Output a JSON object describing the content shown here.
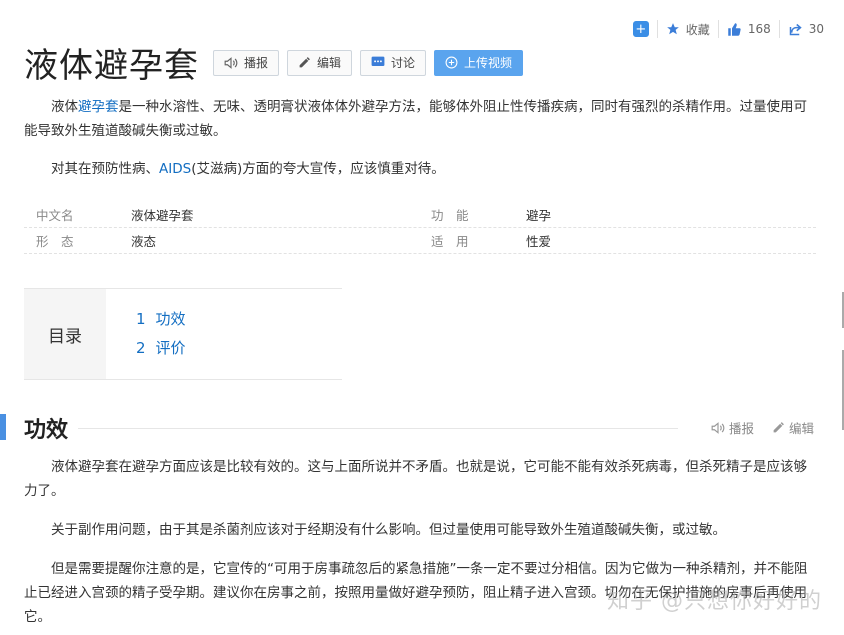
{
  "header": {
    "title": "液体避孕套",
    "buttons": {
      "play": "播报",
      "edit": "编辑",
      "discuss": "讨论",
      "upload": "上传视频"
    }
  },
  "actions": {
    "favorite": "收藏",
    "likes": "168",
    "shares": "30"
  },
  "summary": {
    "p1_before": "液体",
    "p1_link": "避孕套",
    "p1_after": "是一种水溶性、无味、透明膏状液体体外避孕方法，能够体外阻止性传播疾病，同时有强烈的杀精作用。过量使用可能导致外生殖道酸碱失衡或过敏。",
    "p2_before": "对其在预防性病、",
    "p2_link": "AIDS",
    "p2_after": "(艾滋病)方面的夸大宣传，应该慎重对待。"
  },
  "infobox": {
    "rows": [
      {
        "k1": "中文名",
        "v1": "液体避孕套",
        "k2": "功　能",
        "v2": "避孕"
      },
      {
        "k1": "形　态",
        "v1": "液态",
        "k2": "适　用",
        "v2": "性爱"
      }
    ]
  },
  "toc": {
    "label": "目录",
    "items": [
      {
        "n": "1",
        "text": "功效"
      },
      {
        "n": "2",
        "text": "评价"
      }
    ]
  },
  "section": {
    "title": "功效",
    "tools": {
      "play": "播报",
      "edit": "编辑"
    },
    "paragraphs": [
      "液体避孕套在避孕方面应该是比较有效的。这与上面所说并不矛盾。也就是说，它可能不能有效杀死病毒，但杀死精子是应该够力了。",
      "关于副作用问题，由于其是杀菌剂应该对于经期没有什么影响。但过量使用可能导致外生殖道酸碱失衡，或过敏。",
      "但是需要提醒你注意的是，它宣传的“可用于房事疏忽后的紧急措施”一条一定不要过分相信。因为它做为一种杀精剂，并不能阻止已经进入宫颈的精子受孕期。建议你在房事之前，按照用量做好避孕预防，阻止精子进入宫颈。切勿在无保护措施的房事后再使用它。"
    ]
  },
  "watermark": "知乎 @只想你好好的",
  "colors": {
    "link": "#136ec2",
    "accent": "#4a90e2",
    "primary_button": "#5aa4ee"
  }
}
